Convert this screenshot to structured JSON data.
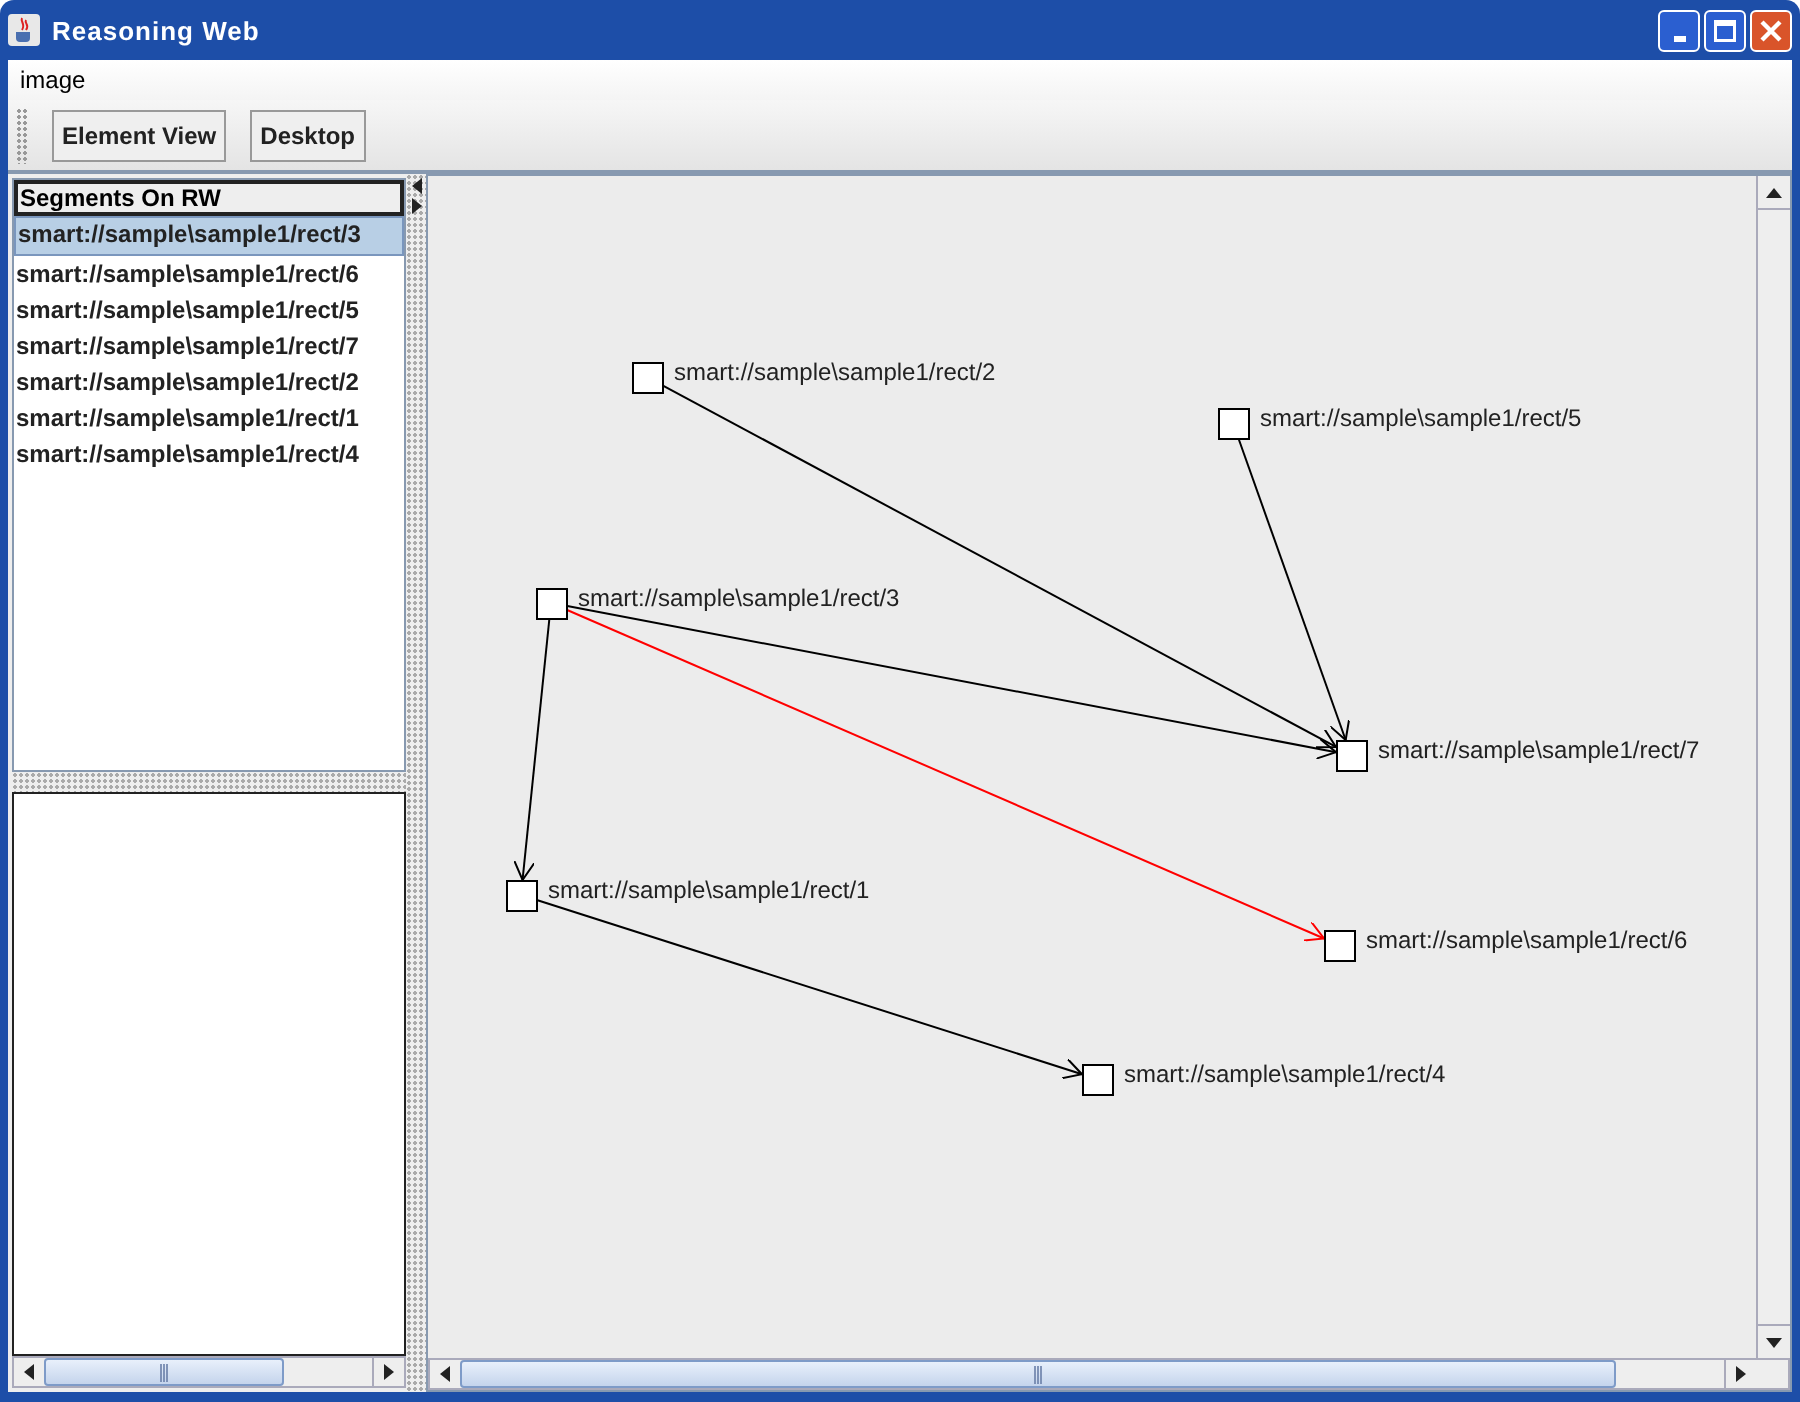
{
  "window": {
    "title": "Reasoning Web"
  },
  "menu": [
    "image"
  ],
  "toolbar": [
    "Element View",
    "Desktop"
  ],
  "segments": {
    "header": "Segments On RW",
    "items": [
      {
        "label": "smart://sample\\sample1/rect/3",
        "selected": true
      },
      {
        "label": "smart://sample\\sample1/rect/6",
        "selected": false
      },
      {
        "label": "smart://sample\\sample1/rect/5",
        "selected": false
      },
      {
        "label": "smart://sample\\sample1/rect/7",
        "selected": false
      },
      {
        "label": "smart://sample\\sample1/rect/2",
        "selected": false
      },
      {
        "label": "smart://sample\\sample1/rect/1",
        "selected": false
      },
      {
        "label": "smart://sample\\sample1/rect/4",
        "selected": false
      }
    ]
  },
  "graph": {
    "nodes": [
      {
        "label": "smart://sample\\sample1/rect/2"
      },
      {
        "label": "smart://sample\\sample1/rect/5"
      },
      {
        "label": "smart://sample\\sample1/rect/3"
      },
      {
        "label": "smart://sample\\sample1/rect/7"
      },
      {
        "label": "smart://sample\\sample1/rect/1"
      },
      {
        "label": "smart://sample\\sample1/rect/6"
      },
      {
        "label": "smart://sample\\sample1/rect/4"
      }
    ],
    "edges": [
      {
        "color": "#000000"
      },
      {
        "color": "#000000"
      },
      {
        "color": "#000000"
      },
      {
        "color": "#000000"
      },
      {
        "color": "#000000"
      },
      {
        "color": "#ff0000"
      }
    ]
  }
}
